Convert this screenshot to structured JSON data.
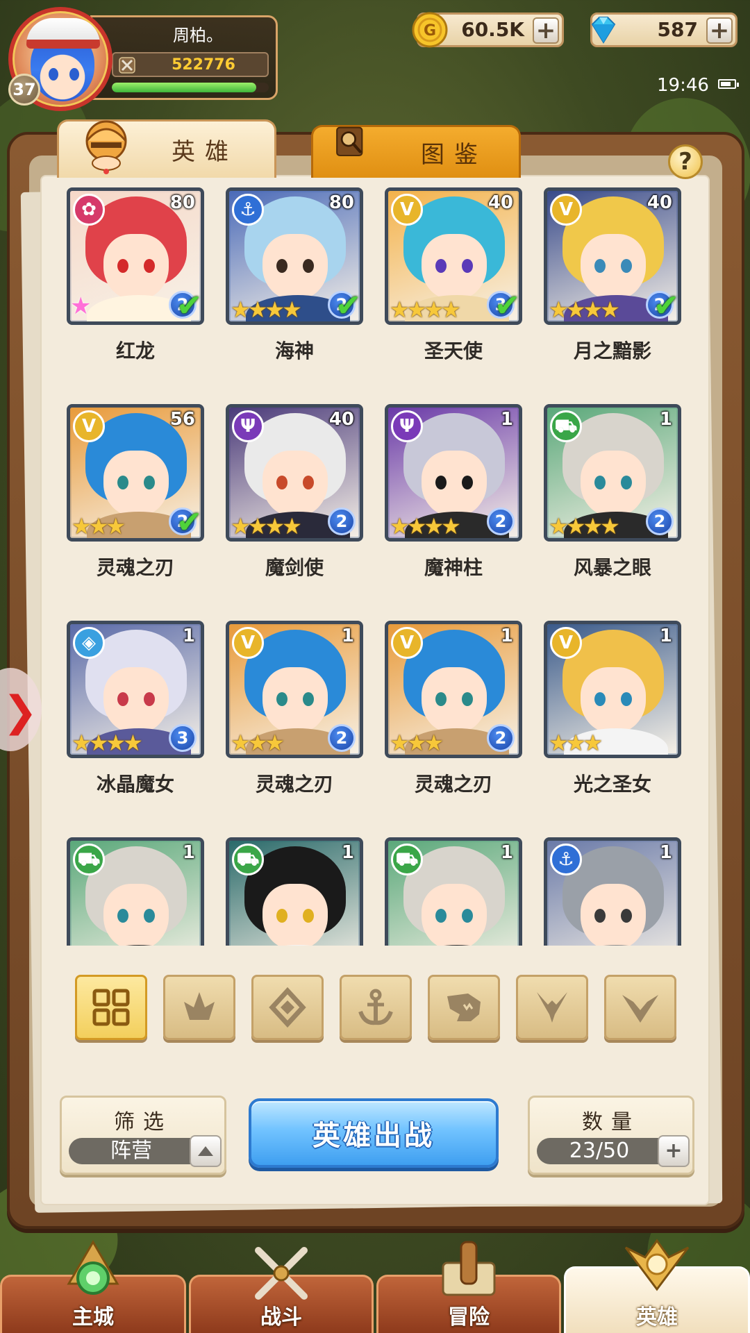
{
  "player": {
    "name": "周柏。",
    "level": "37",
    "power": "522776",
    "exp_fraction": 0.92
  },
  "currencies": [
    {
      "icon": "gold-coin-icon",
      "value": "60.5K"
    },
    {
      "icon": "diamond-icon",
      "value": "587"
    }
  ],
  "status_bar": {
    "time": "19:46",
    "battery_fraction": 0.8
  },
  "tabs": {
    "heroes": "英雄",
    "codex": "图鉴",
    "help": "?"
  },
  "heroes": [
    {
      "name": "红龙",
      "level": "80",
      "faction": "dragon",
      "stars": 0,
      "rank": "2",
      "checked": true,
      "rainbow": true
    },
    {
      "name": "海神",
      "level": "80",
      "faction": "anchor",
      "stars": 4,
      "rank": "2",
      "checked": true
    },
    {
      "name": "圣天使",
      "level": "40",
      "faction": "wing",
      "stars": 4,
      "rank": "3",
      "checked": true
    },
    {
      "name": "月之黯影",
      "level": "40",
      "faction": "wing",
      "stars": 4,
      "rank": "2",
      "checked": true
    },
    {
      "name": "灵魂之刃",
      "level": "56",
      "faction": "wing",
      "stars": 3,
      "rank": "2",
      "checked": true
    },
    {
      "name": "魔剑使",
      "level": "40",
      "faction": "demon",
      "stars": 4,
      "rank": "2",
      "checked": false
    },
    {
      "name": "魔神柱",
      "level": "1",
      "faction": "demon",
      "stars": 4,
      "rank": "2",
      "checked": false
    },
    {
      "name": "风暴之眼",
      "level": "1",
      "faction": "beast",
      "stars": 4,
      "rank": "2",
      "checked": false
    },
    {
      "name": "冰晶魔女",
      "level": "1",
      "faction": "crystal",
      "stars": 4,
      "rank": "3",
      "checked": false
    },
    {
      "name": "灵魂之刃",
      "level": "1",
      "faction": "wing",
      "stars": 3,
      "rank": "2",
      "checked": false
    },
    {
      "name": "灵魂之刃",
      "level": "1",
      "faction": "wing",
      "stars": 3,
      "rank": "2",
      "checked": false
    },
    {
      "name": "光之圣女",
      "level": "1",
      "faction": "wing",
      "stars": 3,
      "rank": "",
      "checked": false
    },
    {
      "name": "",
      "level": "1",
      "faction": "beast",
      "stars": 0,
      "rank": "",
      "checked": false
    },
    {
      "name": "",
      "level": "1",
      "faction": "beast",
      "stars": 0,
      "rank": "",
      "checked": false
    },
    {
      "name": "",
      "level": "1",
      "faction": "beast",
      "stars": 0,
      "rank": "",
      "checked": false
    },
    {
      "name": "",
      "level": "1",
      "faction": "anchor",
      "stars": 0,
      "rank": "",
      "checked": false
    }
  ],
  "faction_filters": [
    {
      "icon": "all-grid-icon",
      "active": true
    },
    {
      "icon": "dragon-faction-icon",
      "active": false
    },
    {
      "icon": "crystal-faction-icon",
      "active": false
    },
    {
      "icon": "anchor-faction-icon",
      "active": false
    },
    {
      "icon": "beast-faction-icon",
      "active": false
    },
    {
      "icon": "demon-faction-icon",
      "active": false
    },
    {
      "icon": "wing-faction-icon",
      "active": false
    }
  ],
  "controls": {
    "filter_title": "筛选",
    "filter_value": "阵营",
    "deploy_label": "英雄出战",
    "count_title": "数量",
    "count_value": "23/50"
  },
  "nav": [
    {
      "label": "主城",
      "icon": "main-city-icon",
      "active": false
    },
    {
      "label": "战斗",
      "icon": "battle-swords-icon",
      "active": false
    },
    {
      "label": "冒险",
      "icon": "adventure-map-icon",
      "active": false
    },
    {
      "label": "英雄",
      "icon": "hero-crest-icon",
      "active": true
    }
  ],
  "colors": {
    "factions": {
      "dragon": "#d63a6a",
      "anchor": "#2f6fd6",
      "wing": "#e8b52a",
      "demon": "#7a3ab8",
      "beast": "#3aa648",
      "crystal": "#3aa0e0"
    },
    "accent_blue": "#3f9ff0",
    "check_green": "#4fd33a"
  }
}
